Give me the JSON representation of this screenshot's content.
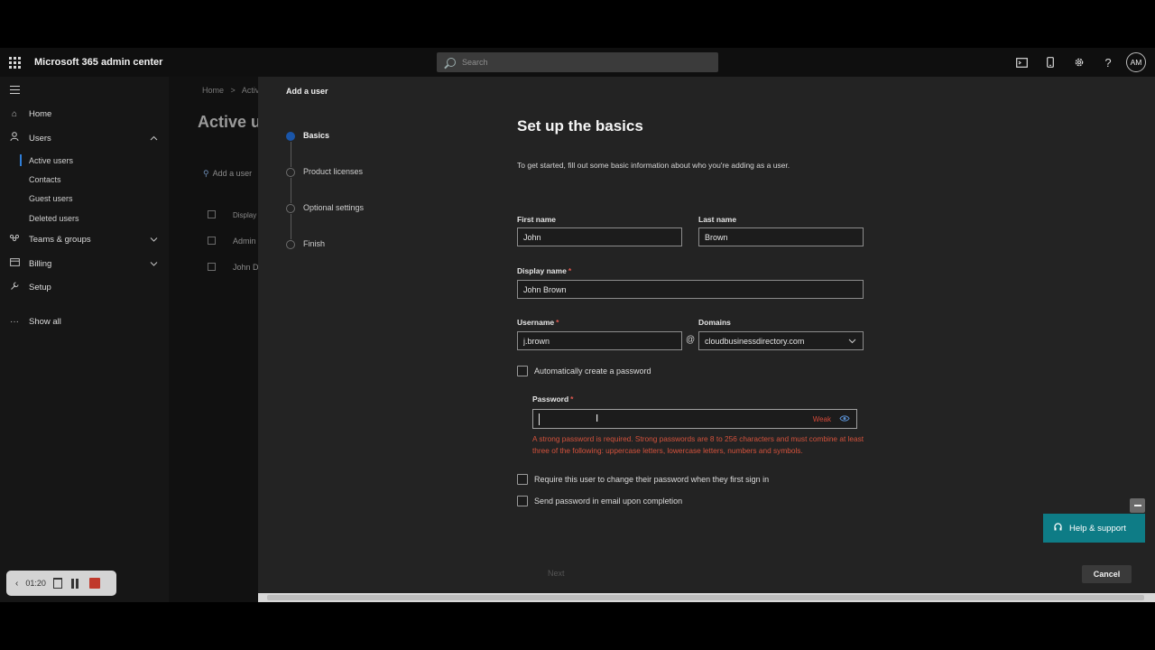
{
  "app": {
    "title": "Microsoft 365 admin center"
  },
  "search": {
    "placeholder": "Search"
  },
  "topbar": {
    "avatar": "AM",
    "help_label": "?"
  },
  "nav": {
    "home": "Home",
    "users": "Users",
    "active_users": "Active users",
    "contacts": "Contacts",
    "guest_users": "Guest users",
    "deleted_users": "Deleted users",
    "teams_groups": "Teams & groups",
    "billing": "Billing",
    "setup": "Setup",
    "show_all": "Show all"
  },
  "background": {
    "breadcrumb_home": "Home",
    "breadcrumb_sep": ">",
    "breadcrumb_current": "Activ",
    "title": "Active u",
    "add_user": "Add a user",
    "col_display": "Display",
    "row1": "Admin",
    "row2": "John D"
  },
  "panel": {
    "title": "Add a user",
    "steps": [
      "Basics",
      "Product licenses",
      "Optional settings",
      "Finish"
    ],
    "form_title": "Set up the basics",
    "intro": "To get started, fill out some basic information about who you're adding as a user.",
    "first_name_label": "First name",
    "first_name_value": "John",
    "last_name_label": "Last name",
    "last_name_value": "Brown",
    "display_name_label": "Display name",
    "display_name_value": "John Brown",
    "username_label": "Username",
    "username_value": "j.brown",
    "at": "@",
    "domains_label": "Domains",
    "domains_value": "cloudbusinessdirectory.com",
    "required_mark": "*",
    "auto_password_label": "Automatically create a password",
    "password_label": "Password",
    "password_value": "",
    "password_strength": "Weak",
    "password_error": "A strong password is required. Strong passwords are 8 to 256 characters and must combine at least three of the following: uppercase letters, lowercase letters, numbers and symbols.",
    "require_change_label": "Require this user to change their password when they first sign in",
    "send_email_label": "Send password in email upon completion",
    "next_label": "Next",
    "cancel_label": "Cancel"
  },
  "help": {
    "label": "Help & support"
  },
  "recorder": {
    "time": "01:20"
  },
  "colors": {
    "accent": "#1a55a8",
    "error": "#d4523c",
    "help_bg": "#0e7c86"
  }
}
